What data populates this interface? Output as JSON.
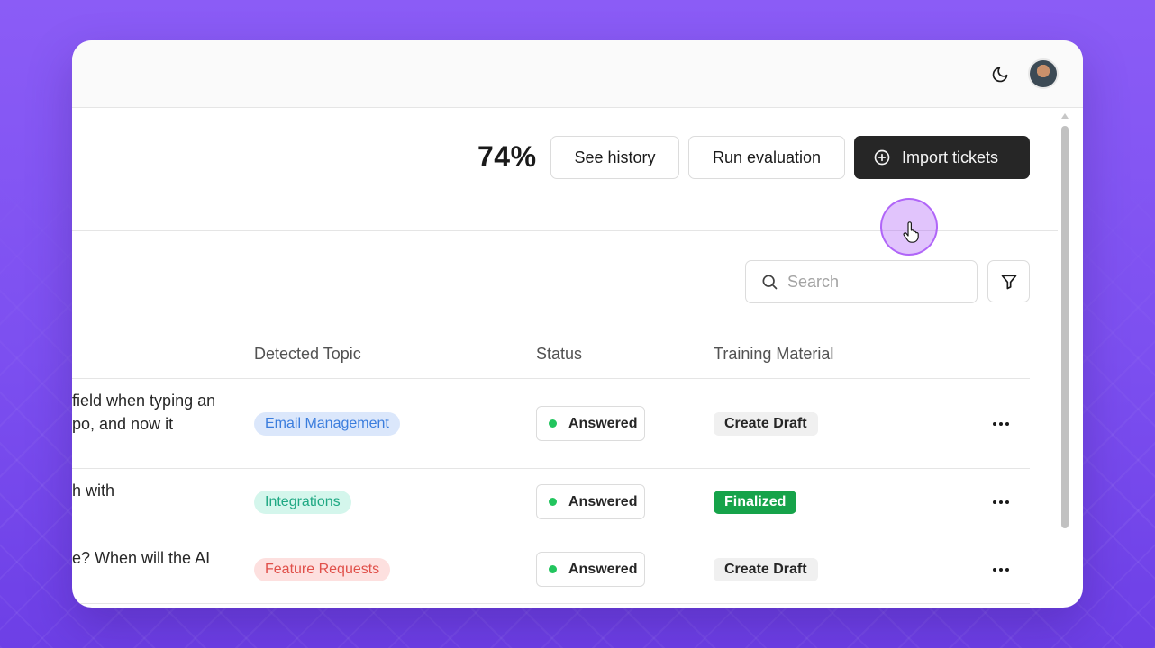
{
  "colors": {
    "background": "#8b5cf6",
    "primary_button": "#262626",
    "answered_dot": "#22c55e",
    "finalized": "#16a34a"
  },
  "header": {
    "score": "74%",
    "see_history_label": "See history",
    "run_evaluation_label": "Run evaluation",
    "import_tickets_label": "Import tickets"
  },
  "search": {
    "placeholder": "Search"
  },
  "table": {
    "columns": [
      "Detected Topic",
      "Status",
      "Training Material"
    ],
    "rows": [
      {
        "text": "field when typing an\npo, and now it\n",
        "topic": "Email Management",
        "status": "Answered",
        "training": "Create Draft"
      },
      {
        "text": "h with",
        "topic": "Integrations",
        "status": "Answered",
        "training": "Finalized"
      },
      {
        "text": "e? When will the AI",
        "topic": "Feature Requests",
        "status": "Answered",
        "training": "Create Draft"
      }
    ]
  },
  "icons": {
    "theme": "moon-icon",
    "import": "plus-circle-icon",
    "search": "search-icon",
    "filter": "filter-icon",
    "row_menu": "more-horizontal-icon"
  }
}
